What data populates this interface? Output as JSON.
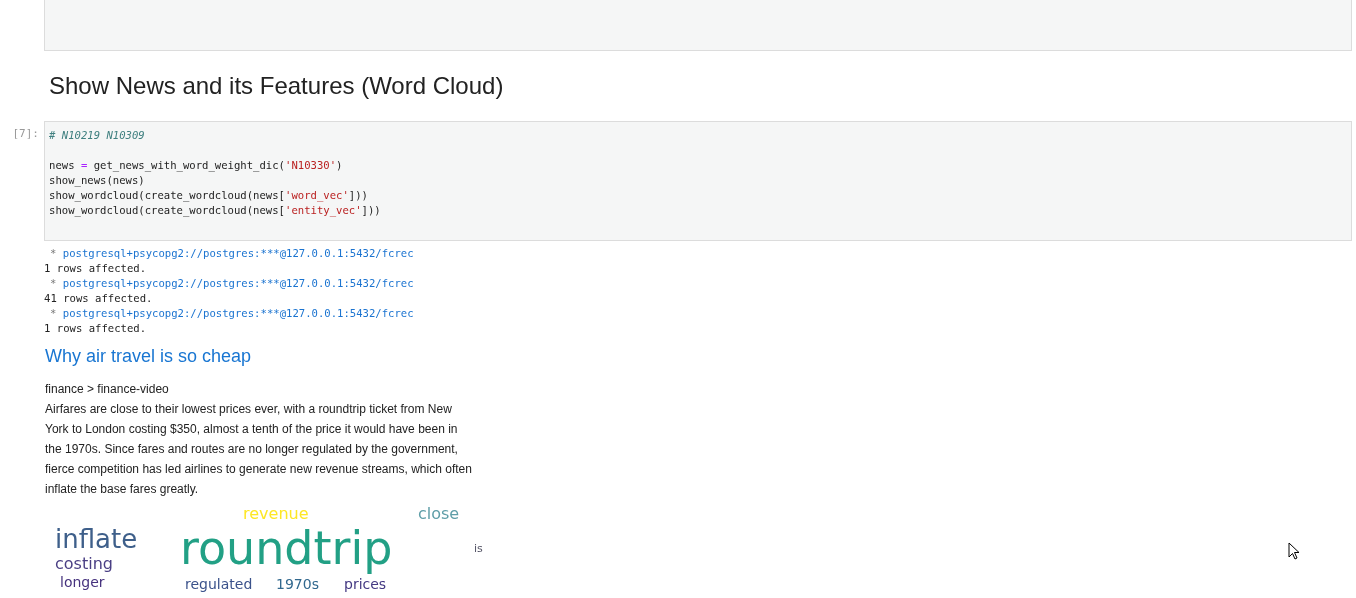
{
  "heading": "Show News and its Features (Word Cloud)",
  "code_cell": {
    "prompt": "[7]:",
    "lines": [
      [
        {
          "kind": "comment",
          "text": "# N10219 N10309"
        }
      ],
      [
        {
          "kind": "plain",
          "text": "news "
        },
        {
          "kind": "operator",
          "text": "="
        },
        {
          "kind": "plain",
          "text": " get_news_with_word_weight_dic("
        },
        {
          "kind": "string",
          "text": "'N10330'"
        },
        {
          "kind": "plain",
          "text": ")"
        }
      ],
      [
        {
          "kind": "plain",
          "text": "show_news(news)"
        }
      ],
      [
        {
          "kind": "plain",
          "text": "show_wordcloud(create_wordcloud(news["
        },
        {
          "kind": "string",
          "text": "'word_vec'"
        },
        {
          "kind": "plain",
          "text": "]))"
        }
      ],
      [
        {
          "kind": "plain",
          "text": "show_wordcloud(create_wordcloud(news["
        },
        {
          "kind": "string",
          "text": "'entity_vec'"
        },
        {
          "kind": "plain",
          "text": "]))"
        }
      ]
    ]
  },
  "output_lines": [
    {
      "kind": "connection",
      "marker": "*",
      "url": "postgresql+psycopg2://postgres:***@127.0.0.1:5432/fcrec"
    },
    {
      "kind": "message",
      "text": "1 rows affected."
    },
    {
      "kind": "connection",
      "marker": "*",
      "url": "postgresql+psycopg2://postgres:***@127.0.0.1:5432/fcrec"
    },
    {
      "kind": "message",
      "text": "41 rows affected."
    },
    {
      "kind": "connection",
      "marker": "*",
      "url": "postgresql+psycopg2://postgres:***@127.0.0.1:5432/fcrec"
    },
    {
      "kind": "message",
      "text": "1 rows affected."
    }
  ],
  "news": {
    "title": "Why air travel is so cheap",
    "category": "finance > finance-video",
    "abstract": "Airfares are close to their lowest prices ever, with a roundtrip ticket from New York to London costing $350, almost a tenth of the price it would have been in the 1970s. Since fares and routes are no longer regulated by the government, fierce competition has led airlines to generate new revenue streams, which often inflate the base fares greatly."
  },
  "word_cloud": [
    {
      "text": "revenue",
      "color": "#fde725"
    },
    {
      "text": "close",
      "color": "#5f9ea8"
    },
    {
      "text": "inflate",
      "color": "#3e5f8a"
    },
    {
      "text": "roundtrip",
      "color": "#22a085"
    },
    {
      "text": "is",
      "color": "#555566"
    },
    {
      "text": "costing",
      "color": "#4a3f84"
    },
    {
      "text": "longer",
      "color": "#46327e"
    },
    {
      "text": "regulated",
      "color": "#3b528b"
    },
    {
      "text": "1970s",
      "color": "#31688e"
    },
    {
      "text": "prices",
      "color": "#443983"
    }
  ]
}
